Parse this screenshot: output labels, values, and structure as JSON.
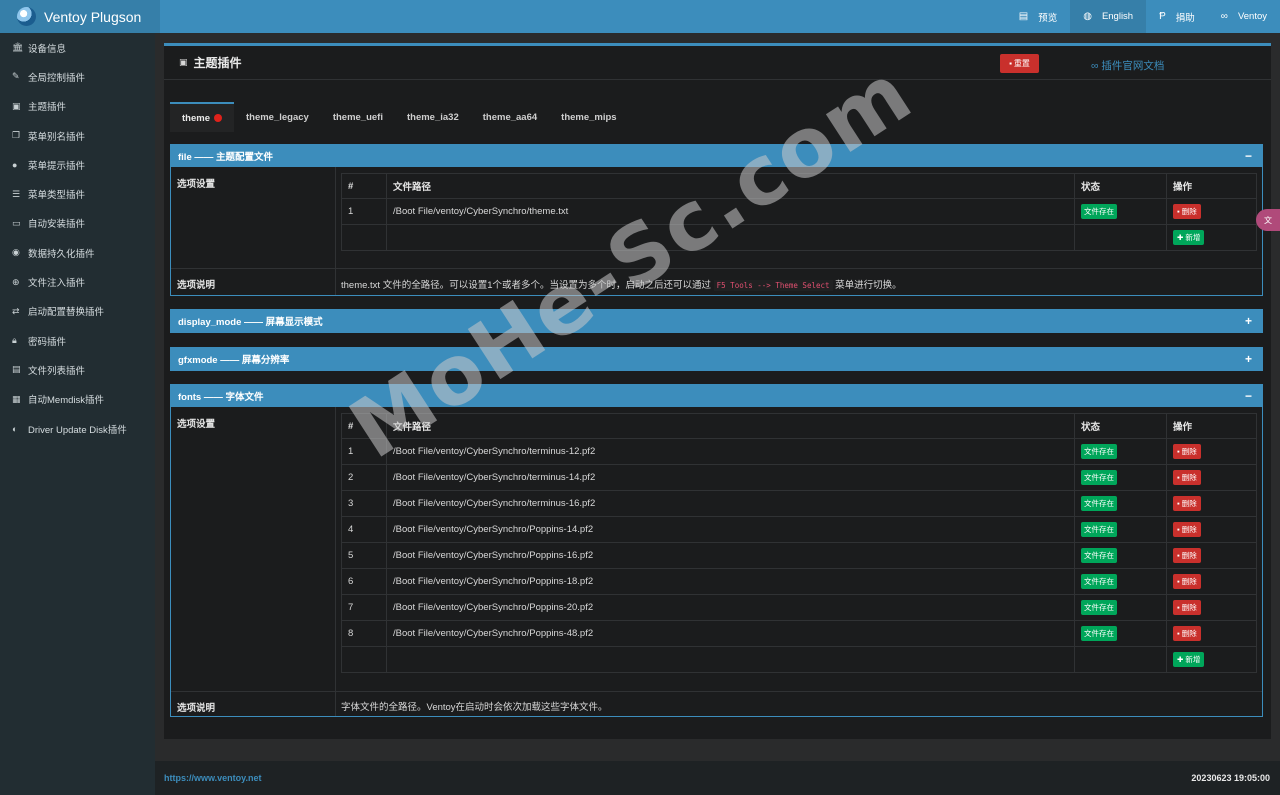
{
  "header": {
    "app_title": "Ventoy Plugson",
    "nav": [
      {
        "icon": "document-icon",
        "label": "预览"
      },
      {
        "icon": "globe-icon",
        "label": "English"
      },
      {
        "icon": "paypal-icon",
        "label": "捐助"
      },
      {
        "icon": "link-icon",
        "label": "Ventoy"
      }
    ]
  },
  "sidebar": {
    "items": [
      {
        "icon": "bank-icon",
        "label": "设备信息"
      },
      {
        "icon": "wrench-icon",
        "label": "全局控制插件"
      },
      {
        "icon": "image-icon",
        "label": "主题插件"
      },
      {
        "icon": "copy-icon",
        "label": "菜单别名插件"
      },
      {
        "icon": "comment-icon",
        "label": "菜单提示插件"
      },
      {
        "icon": "list-icon",
        "label": "菜单类型插件"
      },
      {
        "icon": "desktop-icon",
        "label": "自动安装插件"
      },
      {
        "icon": "database-icon",
        "label": "数据持久化插件"
      },
      {
        "icon": "plus-circle-icon",
        "label": "文件注入插件"
      },
      {
        "icon": "exchange-icon",
        "label": "启动配置替换插件"
      },
      {
        "icon": "lock-icon",
        "label": "密码插件"
      },
      {
        "icon": "table-list-icon",
        "label": "文件列表插件"
      },
      {
        "icon": "hdd-icon",
        "label": "自动Memdisk插件"
      },
      {
        "icon": "disc-icon",
        "label": "Driver Update Disk插件"
      }
    ]
  },
  "main": {
    "title": "主题插件",
    "reset_label": "重置",
    "doc_link": "插件官网文档",
    "tabs": [
      "theme",
      "theme_legacy",
      "theme_uefi",
      "theme_ia32",
      "theme_aa64",
      "theme_mips"
    ],
    "sections": {
      "file": {
        "title": "file —— 主题配置文件",
        "option_label": "选项设置",
        "columns": [
          "#",
          "文件路径",
          "状态",
          "操作"
        ],
        "rows": [
          {
            "n": "1",
            "path": "/Boot File/ventoy/CyberSynchro/theme.txt",
            "status": "文件存在",
            "action": "删除"
          }
        ],
        "add_label": "新增",
        "desc_label": "选项说明",
        "desc_text_1": "theme.txt 文件的全路径。可以设置1个或者多个。当设置为多个时，启动之后还可以通过",
        "desc_code": "F5 Tools --> Theme Select",
        "desc_text_2": "菜单进行切换。"
      },
      "display_mode": {
        "title": "display_mode —— 屏幕显示模式"
      },
      "gfxmode": {
        "title": "gfxmode —— 屏幕分辨率"
      },
      "fonts": {
        "title": "fonts —— 字体文件",
        "option_label": "选项设置",
        "columns": [
          "#",
          "文件路径",
          "状态",
          "操作"
        ],
        "rows": [
          {
            "n": "1",
            "path": "/Boot File/ventoy/CyberSynchro/terminus-12.pf2",
            "status": "文件存在",
            "action": "删除"
          },
          {
            "n": "2",
            "path": "/Boot File/ventoy/CyberSynchro/terminus-14.pf2",
            "status": "文件存在",
            "action": "删除"
          },
          {
            "n": "3",
            "path": "/Boot File/ventoy/CyberSynchro/terminus-16.pf2",
            "status": "文件存在",
            "action": "删除"
          },
          {
            "n": "4",
            "path": "/Boot File/ventoy/CyberSynchro/Poppins-14.pf2",
            "status": "文件存在",
            "action": "删除"
          },
          {
            "n": "5",
            "path": "/Boot File/ventoy/CyberSynchro/Poppins-16.pf2",
            "status": "文件存在",
            "action": "删除"
          },
          {
            "n": "6",
            "path": "/Boot File/ventoy/CyberSynchro/Poppins-18.pf2",
            "status": "文件存在",
            "action": "删除"
          },
          {
            "n": "7",
            "path": "/Boot File/ventoy/CyberSynchro/Poppins-20.pf2",
            "status": "文件存在",
            "action": "删除"
          },
          {
            "n": "8",
            "path": "/Boot File/ventoy/CyberSynchro/Poppins-48.pf2",
            "status": "文件存在",
            "action": "删除"
          }
        ],
        "add_label": "新增",
        "desc_label": "选项说明",
        "desc_text": "字体文件的全路径。Ventoy在启动时会依次加载这些字体文件。"
      }
    }
  },
  "footer": {
    "url": "https://www.ventoy.net",
    "version": "20230623 19:05:00"
  },
  "watermark": "MoHe-Sc.com",
  "colors": {
    "accent": "#3c8dbc",
    "danger": "#c9302c",
    "success": "#00a65a",
    "sidebar": "#222d32"
  }
}
